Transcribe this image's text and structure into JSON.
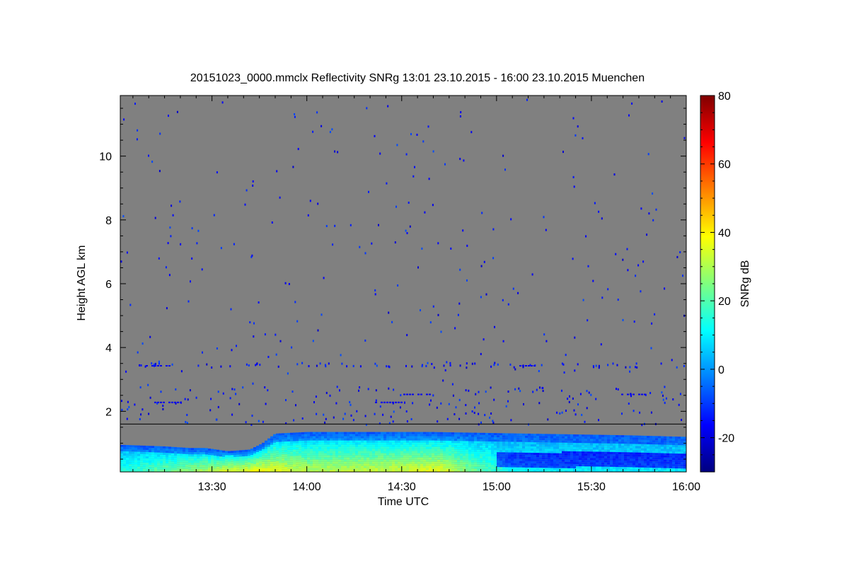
{
  "chart_data": {
    "type": "heatmap",
    "title": "20151023_0000.mmclx Reflectivity SNRg   13:01 23.10.2015 - 16:00 23.10.2015 Muenchen",
    "xlabel": "Time UTC",
    "ylabel": "Height AGL km",
    "colorbar_label": "SNRg dB",
    "x_range_min": [
      781,
      960
    ],
    "y_range_km": [
      0.1,
      11.9
    ],
    "color_range_db": [
      -30,
      80
    ],
    "x_ticks": [
      {
        "min": 810,
        "label": "13:30"
      },
      {
        "min": 840,
        "label": "14:00"
      },
      {
        "min": 870,
        "label": "14:30"
      },
      {
        "min": 900,
        "label": "15:00"
      },
      {
        "min": 930,
        "label": "15:30"
      },
      {
        "min": 960,
        "label": "16:00"
      }
    ],
    "y_ticks": [
      {
        "km": 2,
        "label": "2"
      },
      {
        "km": 4,
        "label": "4"
      },
      {
        "km": 6,
        "label": "6"
      },
      {
        "km": 8,
        "label": "8"
      },
      {
        "km": 10,
        "label": "10"
      }
    ],
    "colorbar_ticks": [
      {
        "db": -20,
        "label": "-20"
      },
      {
        "db": 0,
        "label": "0"
      },
      {
        "db": 20,
        "label": "20"
      },
      {
        "db": 40,
        "label": "40"
      },
      {
        "db": 60,
        "label": "60"
      },
      {
        "db": 80,
        "label": "80"
      }
    ],
    "range_gate_line_km": 1.6,
    "background_color": "#808080",
    "layer_top_km": [
      {
        "min": 781,
        "km": 0.95
      },
      {
        "min": 795,
        "km": 0.9
      },
      {
        "min": 803,
        "km": 0.85
      },
      {
        "min": 808,
        "km": 0.85
      },
      {
        "min": 815,
        "km": 0.75
      },
      {
        "min": 822,
        "km": 0.8
      },
      {
        "min": 826,
        "km": 1.0
      },
      {
        "min": 830,
        "km": 1.3
      },
      {
        "min": 840,
        "km": 1.35
      },
      {
        "min": 880,
        "km": 1.35
      },
      {
        "min": 910,
        "km": 1.3
      },
      {
        "min": 940,
        "km": 1.25
      },
      {
        "min": 960,
        "km": 1.2
      }
    ],
    "layer_bottom_km": 0.1,
    "surface_max_snr": [
      {
        "min": 781,
        "db": 15
      },
      {
        "min": 805,
        "db": 30
      },
      {
        "min": 815,
        "db": 38
      },
      {
        "min": 825,
        "db": 40
      },
      {
        "min": 840,
        "db": 32
      },
      {
        "min": 860,
        "db": 34
      },
      {
        "min": 875,
        "db": 36
      },
      {
        "min": 882,
        "db": 38
      },
      {
        "min": 892,
        "db": 25
      },
      {
        "min": 905,
        "db": 12
      },
      {
        "min": 930,
        "db": 10
      },
      {
        "min": 960,
        "db": 10
      }
    ]
  }
}
